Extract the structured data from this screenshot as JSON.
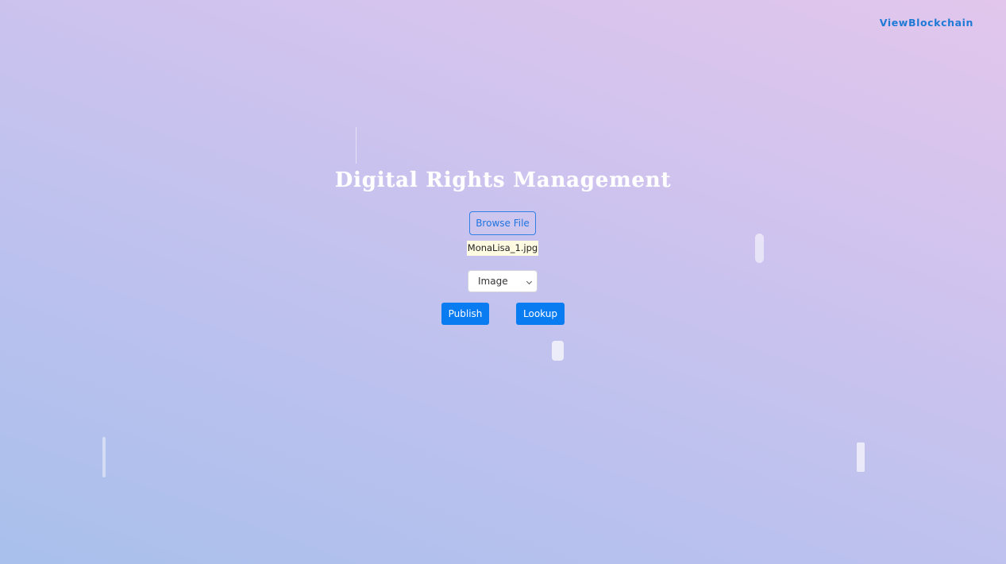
{
  "nav": {
    "view_blockchain": "ViewBlockchain"
  },
  "main": {
    "title": "Digital Rights Management",
    "browse_label": "Browse File",
    "selected_file": "MonaLisa_1.jpg",
    "type_select": {
      "value": "Image"
    },
    "publish_label": "Publish",
    "lookup_label": "Lookup"
  },
  "colors": {
    "link": "#1f7ad6",
    "primary_button": "#0a7cf2",
    "title_text": "#ffffff",
    "filename_bg": "#fffbe3"
  }
}
